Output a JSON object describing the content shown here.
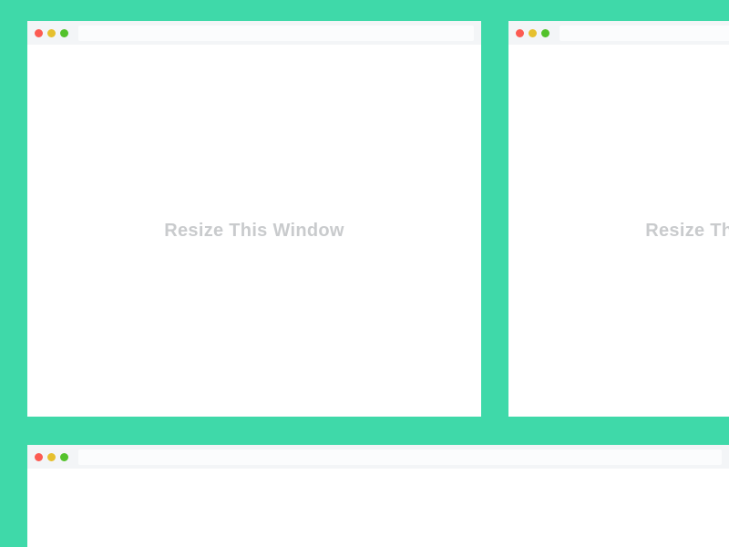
{
  "windows": [
    {
      "message": "Resize This Window"
    },
    {
      "message": "Resize This Window"
    },
    {
      "message": ""
    }
  ],
  "colors": {
    "background": "#3fd9a9",
    "titlebar": "#f3f5f7",
    "close": "#fc5b52",
    "minimize": "#e6c02e",
    "maximize": "#53c22b",
    "text": "#c9cbcd"
  }
}
